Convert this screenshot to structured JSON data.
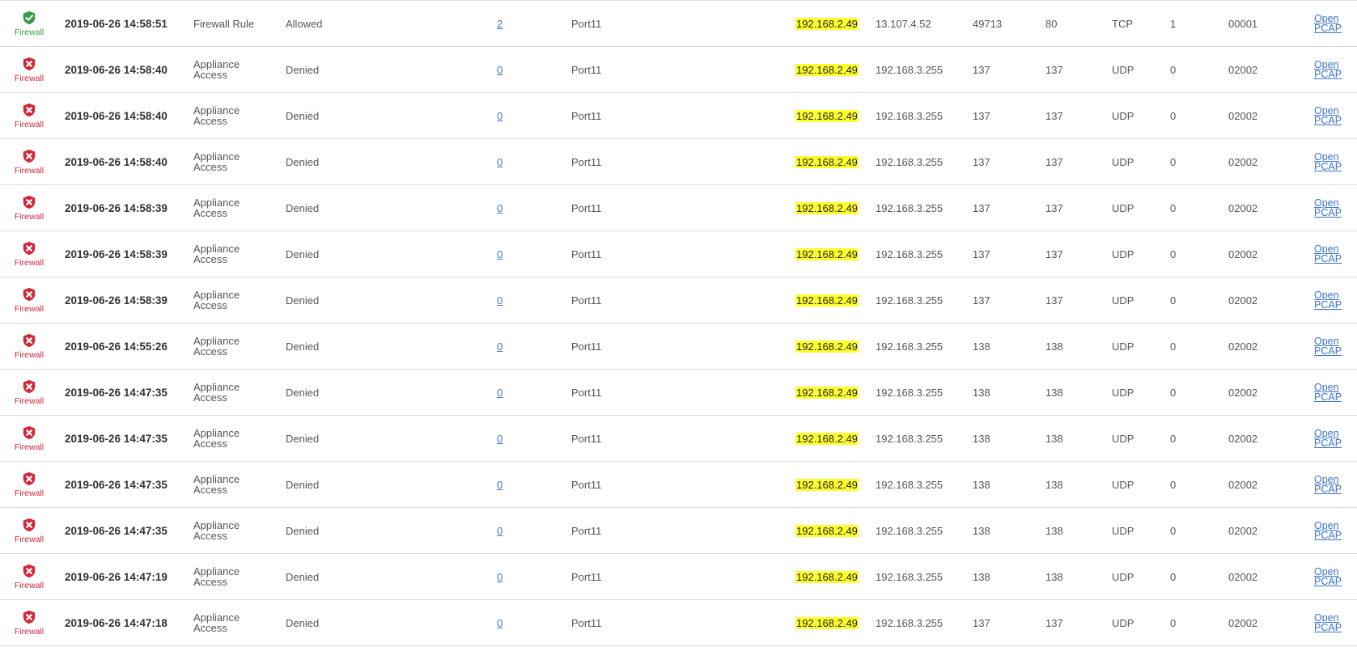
{
  "icons": {
    "allowed": "shield-check-icon",
    "denied": "shield-x-icon"
  },
  "colors": {
    "allowed": "#3d9a48",
    "denied": "#d0293a",
    "link": "#3b73c8",
    "highlight": "#ffff2e"
  },
  "rows": [
    {
      "status": "allowed",
      "module": "Firewall",
      "time": "2019-06-26 14:58:51",
      "type": "Firewall Rule",
      "action": "Allowed",
      "count": "2",
      "iface": "Port11",
      "src_ip": "192.168.2.49",
      "dst_ip": "13.107.4.52",
      "src_port": "49713",
      "dst_port": "80",
      "proto": "TCP",
      "rule": "1",
      "id": "00001",
      "pcap": "Open PCAP"
    },
    {
      "status": "denied",
      "module": "Firewall",
      "time": "2019-06-26 14:58:40",
      "type": "Appliance Access",
      "action": "Denied",
      "count": "0",
      "iface": "Port11",
      "src_ip": "192.168.2.49",
      "dst_ip": "192.168.3.255",
      "src_port": "137",
      "dst_port": "137",
      "proto": "UDP",
      "rule": "0",
      "id": "02002",
      "pcap": "Open PCAP"
    },
    {
      "status": "denied",
      "module": "Firewall",
      "time": "2019-06-26 14:58:40",
      "type": "Appliance Access",
      "action": "Denied",
      "count": "0",
      "iface": "Port11",
      "src_ip": "192.168.2.49",
      "dst_ip": "192.168.3.255",
      "src_port": "137",
      "dst_port": "137",
      "proto": "UDP",
      "rule": "0",
      "id": "02002",
      "pcap": "Open PCAP"
    },
    {
      "status": "denied",
      "module": "Firewall",
      "time": "2019-06-26 14:58:40",
      "type": "Appliance Access",
      "action": "Denied",
      "count": "0",
      "iface": "Port11",
      "src_ip": "192.168.2.49",
      "dst_ip": "192.168.3.255",
      "src_port": "137",
      "dst_port": "137",
      "proto": "UDP",
      "rule": "0",
      "id": "02002",
      "pcap": "Open PCAP"
    },
    {
      "status": "denied",
      "module": "Firewall",
      "time": "2019-06-26 14:58:39",
      "type": "Appliance Access",
      "action": "Denied",
      "count": "0",
      "iface": "Port11",
      "src_ip": "192.168.2.49",
      "dst_ip": "192.168.3.255",
      "src_port": "137",
      "dst_port": "137",
      "proto": "UDP",
      "rule": "0",
      "id": "02002",
      "pcap": "Open PCAP"
    },
    {
      "status": "denied",
      "module": "Firewall",
      "time": "2019-06-26 14:58:39",
      "type": "Appliance Access",
      "action": "Denied",
      "count": "0",
      "iface": "Port11",
      "src_ip": "192.168.2.49",
      "dst_ip": "192.168.3.255",
      "src_port": "137",
      "dst_port": "137",
      "proto": "UDP",
      "rule": "0",
      "id": "02002",
      "pcap": "Open PCAP"
    },
    {
      "status": "denied",
      "module": "Firewall",
      "time": "2019-06-26 14:58:39",
      "type": "Appliance Access",
      "action": "Denied",
      "count": "0",
      "iface": "Port11",
      "src_ip": "192.168.2.49",
      "dst_ip": "192.168.3.255",
      "src_port": "137",
      "dst_port": "137",
      "proto": "UDP",
      "rule": "0",
      "id": "02002",
      "pcap": "Open PCAP"
    },
    {
      "status": "denied",
      "module": "Firewall",
      "time": "2019-06-26 14:55:26",
      "type": "Appliance Access",
      "action": "Denied",
      "count": "0",
      "iface": "Port11",
      "src_ip": "192.168.2.49",
      "dst_ip": "192.168.3.255",
      "src_port": "138",
      "dst_port": "138",
      "proto": "UDP",
      "rule": "0",
      "id": "02002",
      "pcap": "Open PCAP"
    },
    {
      "status": "denied",
      "module": "Firewall",
      "time": "2019-06-26 14:47:35",
      "type": "Appliance Access",
      "action": "Denied",
      "count": "0",
      "iface": "Port11",
      "src_ip": "192.168.2.49",
      "dst_ip": "192.168.3.255",
      "src_port": "138",
      "dst_port": "138",
      "proto": "UDP",
      "rule": "0",
      "id": "02002",
      "pcap": "Open PCAP"
    },
    {
      "status": "denied",
      "module": "Firewall",
      "time": "2019-06-26 14:47:35",
      "type": "Appliance Access",
      "action": "Denied",
      "count": "0",
      "iface": "Port11",
      "src_ip": "192.168.2.49",
      "dst_ip": "192.168.3.255",
      "src_port": "138",
      "dst_port": "138",
      "proto": "UDP",
      "rule": "0",
      "id": "02002",
      "pcap": "Open PCAP"
    },
    {
      "status": "denied",
      "module": "Firewall",
      "time": "2019-06-26 14:47:35",
      "type": "Appliance Access",
      "action": "Denied",
      "count": "0",
      "iface": "Port11",
      "src_ip": "192.168.2.49",
      "dst_ip": "192.168.3.255",
      "src_port": "138",
      "dst_port": "138",
      "proto": "UDP",
      "rule": "0",
      "id": "02002",
      "pcap": "Open PCAP"
    },
    {
      "status": "denied",
      "module": "Firewall",
      "time": "2019-06-26 14:47:35",
      "type": "Appliance Access",
      "action": "Denied",
      "count": "0",
      "iface": "Port11",
      "src_ip": "192.168.2.49",
      "dst_ip": "192.168.3.255",
      "src_port": "138",
      "dst_port": "138",
      "proto": "UDP",
      "rule": "0",
      "id": "02002",
      "pcap": "Open PCAP"
    },
    {
      "status": "denied",
      "module": "Firewall",
      "time": "2019-06-26 14:47:19",
      "type": "Appliance Access",
      "action": "Denied",
      "count": "0",
      "iface": "Port11",
      "src_ip": "192.168.2.49",
      "dst_ip": "192.168.3.255",
      "src_port": "138",
      "dst_port": "138",
      "proto": "UDP",
      "rule": "0",
      "id": "02002",
      "pcap": "Open PCAP"
    },
    {
      "status": "denied",
      "module": "Firewall",
      "time": "2019-06-26 14:47:18",
      "type": "Appliance Access",
      "action": "Denied",
      "count": "0",
      "iface": "Port11",
      "src_ip": "192.168.2.49",
      "dst_ip": "192.168.3.255",
      "src_port": "137",
      "dst_port": "137",
      "proto": "UDP",
      "rule": "0",
      "id": "02002",
      "pcap": "Open PCAP"
    }
  ]
}
